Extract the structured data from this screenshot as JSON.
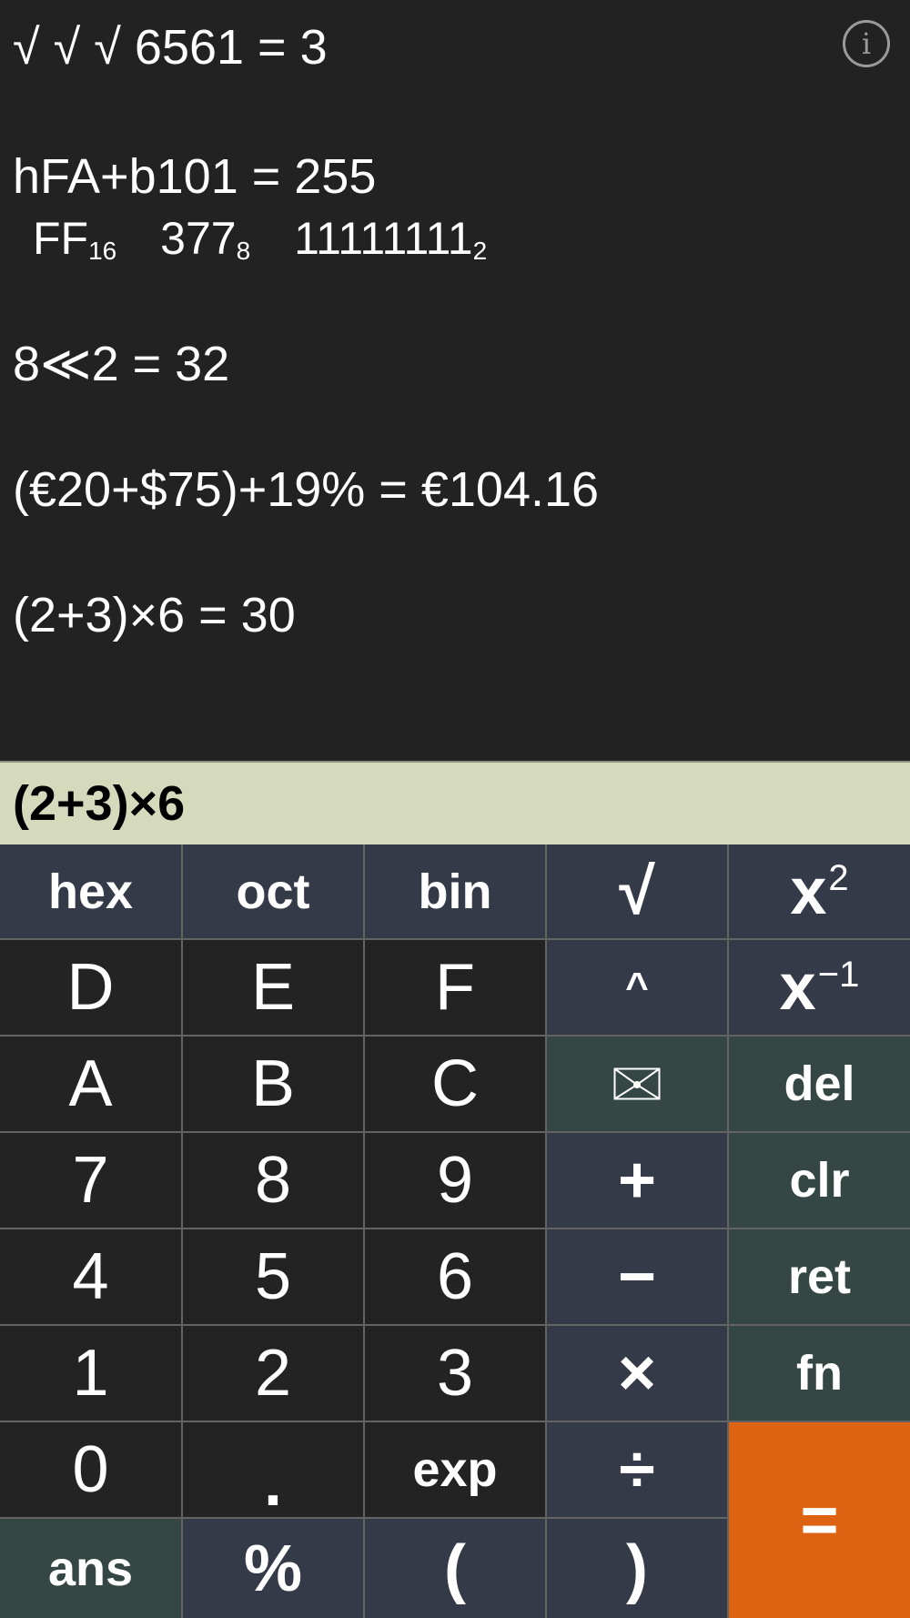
{
  "history": [
    {
      "expr": "√ √ √ 6561 = 3"
    },
    {
      "expr": "hFA+b101 = 255"
    },
    {
      "conversions": [
        {
          "value": "FF",
          "base": "16"
        },
        {
          "value": "377",
          "base": "8"
        },
        {
          "value": "11111111",
          "base": "2"
        }
      ]
    },
    {
      "expr": "8≪2 = 32"
    },
    {
      "expr": "(€20+$75)+19% = €104.16"
    },
    {
      "expr": "(2+3)×6 = 30"
    }
  ],
  "info_icon": "i",
  "input": {
    "value": "(2+3)×6"
  },
  "keys": {
    "hex": "hex",
    "oct": "oct",
    "bin": "bin",
    "sqrt": "√",
    "x": "x",
    "sq_exp": "2",
    "D": "D",
    "E": "E",
    "F": "F",
    "pow": "^",
    "inv_exp": "−1",
    "A": "A",
    "B": "B",
    "C": "C",
    "del": "del",
    "n7": "7",
    "n8": "8",
    "n9": "9",
    "plus": "+",
    "clr": "clr",
    "n4": "4",
    "n5": "5",
    "n6": "6",
    "minus": "−",
    "ret": "ret",
    "n1": "1",
    "n2": "2",
    "n3": "3",
    "times": "×",
    "fn": "fn",
    "n0": "0",
    "dot": ".",
    "exp": "exp",
    "divide": "÷",
    "equals": "=",
    "ans": "ans",
    "percent": "%",
    "lparen": "(",
    "rparen": ")"
  },
  "colors": {
    "history_bg": "#222223",
    "input_bg": "#d6dabd",
    "key_dark": "#232324",
    "key_slate": "#353a48",
    "key_green": "#354744",
    "key_orange": "#dd6313"
  }
}
